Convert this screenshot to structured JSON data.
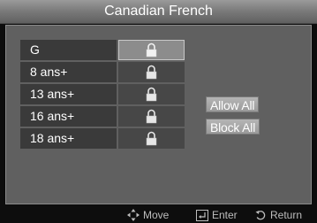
{
  "window": {
    "title": "Canadian French"
  },
  "ratings": [
    {
      "label": "G",
      "locked": true,
      "selected": true
    },
    {
      "label": "8 ans+",
      "locked": true,
      "selected": false
    },
    {
      "label": "13 ans+",
      "locked": true,
      "selected": false
    },
    {
      "label": "16 ans+",
      "locked": true,
      "selected": false
    },
    {
      "label": "18 ans+",
      "locked": true,
      "selected": false
    }
  ],
  "buttons": {
    "allow_all": "Allow All",
    "block_all": "Block All"
  },
  "footer": {
    "move": "Move",
    "enter": "Enter",
    "return": "Return"
  },
  "icons": {
    "lock": "lock-icon",
    "move": "move-arrows-icon",
    "enter": "enter-icon",
    "return": "return-icon"
  },
  "colors": {
    "title_bar": "#7c7c7c",
    "panel": "#606060",
    "rating_label_bg": "#3a3a3a",
    "lock_cell_bg": "#474747",
    "selected_cell_bg": "#8c8c8c",
    "button_bg": "#a8a8a8",
    "footer_text": "#bdbdbd"
  }
}
